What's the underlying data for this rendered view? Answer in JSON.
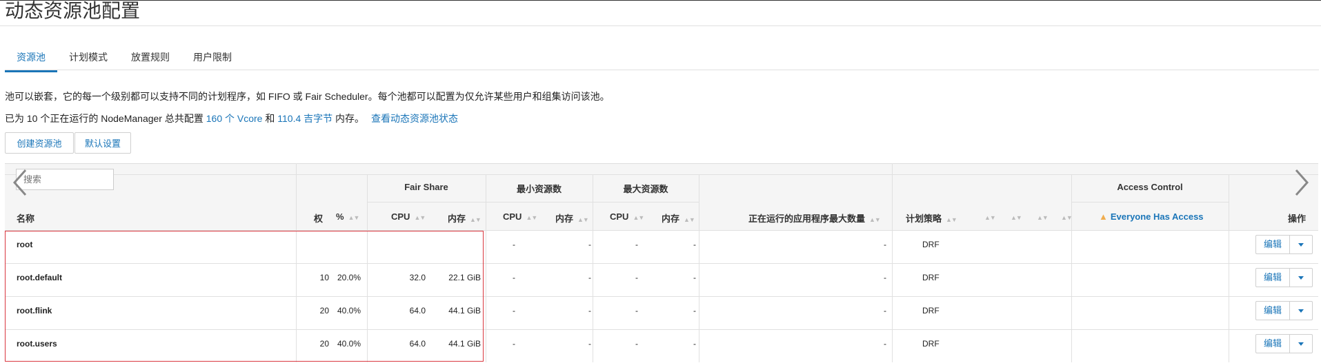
{
  "page": {
    "title": "动态资源池配置"
  },
  "tabs": [
    {
      "label": "资源池",
      "active": true
    },
    {
      "label": "计划模式",
      "active": false
    },
    {
      "label": "放置规则",
      "active": false
    },
    {
      "label": "用户限制",
      "active": false
    }
  ],
  "description": {
    "line1": "池可以嵌套，它的每一个级别都可以支持不同的计划程序，如 FIFO 或 Fair Scheduler。每个池都可以配置为仅允许某些用户和组集访问该池。",
    "line2_prefix": "已为 10 个正在运行的 NodeManager 总共配置 ",
    "line2_vcore": "160 个 Vcore",
    "line2_mid": " 和 ",
    "line2_mem": "110.4 吉字节",
    "line2_suffix": " 内存。",
    "line2_link": "查看动态资源池状态"
  },
  "buttons": {
    "create": "创建资源池",
    "defaults": "默认设置"
  },
  "search": {
    "placeholder": "搜索"
  },
  "table": {
    "groups": {
      "fair_share": "Fair Share",
      "min": "最小资源数",
      "max": "最大资源数",
      "access_control": "Access Control"
    },
    "headers": {
      "name": "名称",
      "weight": "权",
      "percent": "%",
      "fs_cpu": "CPU",
      "fs_mem": "内存",
      "min_cpu": "CPU",
      "min_mem": "内存",
      "max_cpu": "CPU",
      "max_mem": "内存",
      "max_apps": "正在运行的应用程序最大数量",
      "policy": "计划策略",
      "everyone": "Everyone Has Access",
      "actions": "操作"
    },
    "rows": [
      {
        "name": "root",
        "weight": "",
        "percent": "",
        "cpu": "",
        "mem": "",
        "min_cpu": "-",
        "min_mem": "-",
        "max_cpu": "-",
        "max_mem": "-",
        "max_apps": "-",
        "policy": "DRF",
        "edit": "编辑"
      },
      {
        "name": "root.default",
        "weight": "10",
        "percent": "20.0%",
        "cpu": "32.0",
        "mem": "22.1 GiB",
        "min_cpu": "-",
        "min_mem": "-",
        "max_cpu": "-",
        "max_mem": "-",
        "max_apps": "-",
        "policy": "DRF",
        "edit": "编辑"
      },
      {
        "name": "root.flink",
        "weight": "20",
        "percent": "40.0%",
        "cpu": "64.0",
        "mem": "44.1 GiB",
        "min_cpu": "-",
        "min_mem": "-",
        "max_cpu": "-",
        "max_mem": "-",
        "max_apps": "-",
        "policy": "DRF",
        "edit": "编辑"
      },
      {
        "name": "root.users",
        "weight": "20",
        "percent": "40.0%",
        "cpu": "64.0",
        "mem": "44.1 GiB",
        "min_cpu": "-",
        "min_mem": "-",
        "max_cpu": "-",
        "max_mem": "-",
        "max_apps": "-",
        "policy": "DRF",
        "edit": "编辑"
      }
    ]
  },
  "colors": {
    "accent": "#1a75b8",
    "highlight_box": "#d9363e",
    "warning": "#f0ad4e"
  },
  "icons": {
    "prev": "chevron-left-icon",
    "next": "chevron-right-icon",
    "warning": "warning-triangle-icon",
    "dropdown": "caret-down-icon",
    "sort": "sort-icon"
  }
}
